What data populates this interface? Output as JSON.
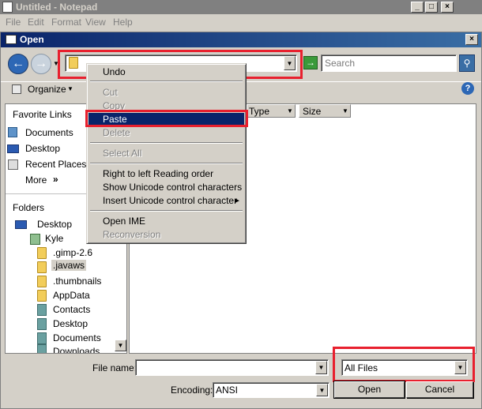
{
  "notepad": {
    "title": "Untitled - Notepad",
    "menu": [
      "File",
      "Edit",
      "Format",
      "View",
      "Help"
    ],
    "caption_buttons": [
      "_",
      "□",
      "×"
    ]
  },
  "dialog": {
    "title": "Open",
    "close_glyph": "×",
    "search_placeholder": "Search",
    "address_value": "",
    "organize_label": "Organize",
    "favorite_links_heading": "Favorite Links",
    "favorites": [
      "Documents",
      "Desktop",
      "Recent Places",
      "More"
    ],
    "more_chevron": "»",
    "folders_heading": "Folders",
    "tree": [
      "Desktop",
      "Kyle",
      ".gimp-2.6",
      ".javaws",
      ".thumbnails",
      "AppData",
      "Contacts",
      "Desktop",
      "Documents",
      "Downloads"
    ],
    "columns": [
      "Type",
      "Size"
    ],
    "file_name_label": "File name:",
    "file_name_value": "",
    "filter_value": "All Files",
    "encoding_label": "Encoding:",
    "encoding_value": "ANSI",
    "open_button": "Open",
    "cancel_button": "Cancel"
  },
  "context_menu": {
    "items": [
      {
        "label": "Undo",
        "enabled": true
      },
      {
        "label": "Cut",
        "enabled": false
      },
      {
        "label": "Copy",
        "enabled": false
      },
      {
        "label": "Paste",
        "enabled": true,
        "highlighted": true
      },
      {
        "label": "Delete",
        "enabled": false
      },
      {
        "label": "Select All",
        "enabled": false
      },
      {
        "label": "Right to left Reading order",
        "enabled": true
      },
      {
        "label": "Show Unicode control characters",
        "enabled": true
      },
      {
        "label": "Insert Unicode control character",
        "enabled": true,
        "submenu": true
      },
      {
        "label": "Open IME",
        "enabled": true
      },
      {
        "label": "Reconversion",
        "enabled": false
      }
    ],
    "submenu_arrow": "▶"
  },
  "colors": {
    "highlight": "#0a246a",
    "annotation_red": "#e8202e",
    "title_gradient_start": "#0a246a",
    "title_gradient_end": "#3a6ea5"
  }
}
